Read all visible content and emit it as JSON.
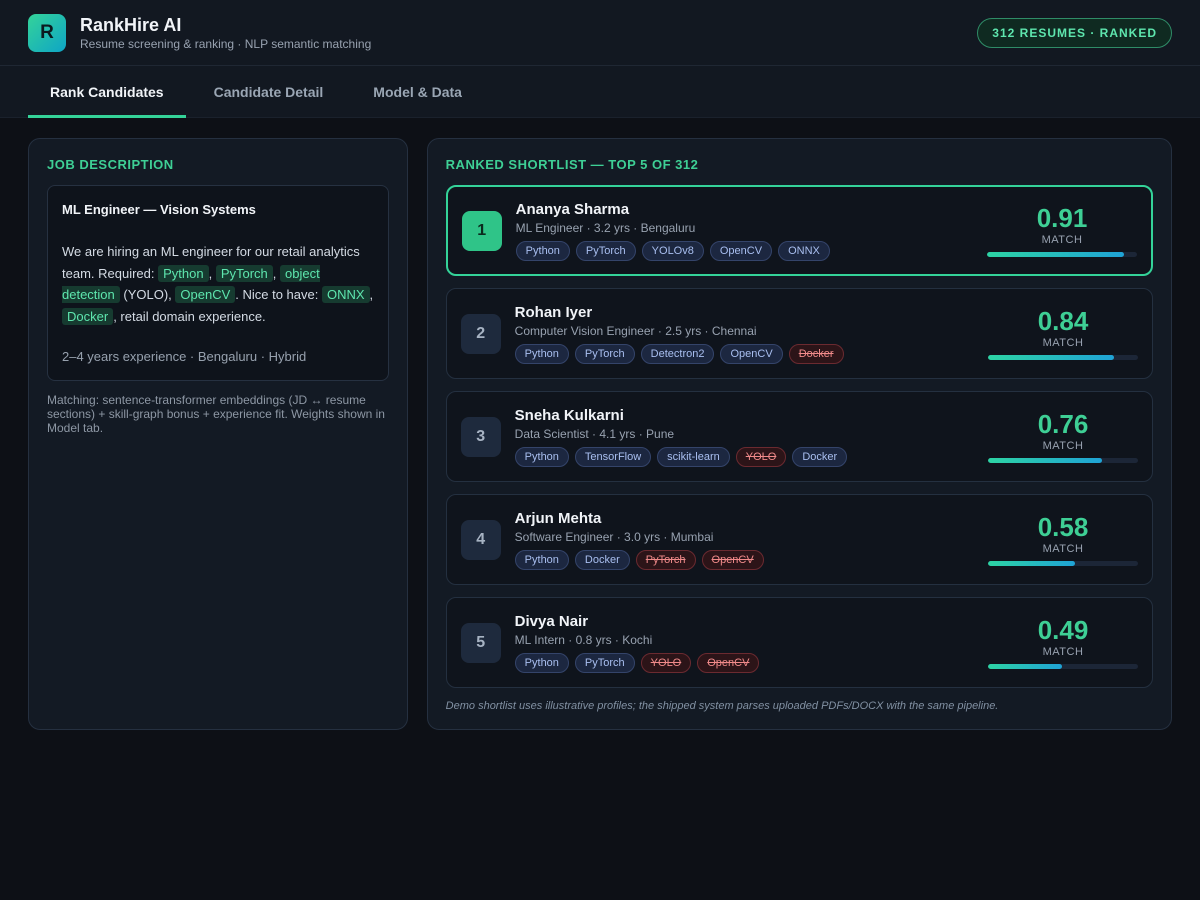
{
  "header": {
    "logo_letter": "R",
    "title": "RankHire AI",
    "subtitle": "Resume screening & ranking · NLP semantic matching",
    "pill": "312 RESUMES · RANKED"
  },
  "tabs": [
    {
      "label": "Rank Candidates",
      "active": true
    },
    {
      "label": "Candidate Detail",
      "active": false
    },
    {
      "label": "Model & Data",
      "active": false
    }
  ],
  "job": {
    "section_title": "JOB DESCRIPTION",
    "title": "ML Engineer — Vision Systems",
    "body_parts": [
      {
        "text": "We are hiring an ML engineer for our retail analytics team. Required: ",
        "hl": false
      },
      {
        "text": "Python",
        "hl": true
      },
      {
        "text": ", ",
        "hl": false
      },
      {
        "text": "PyTorch",
        "hl": true
      },
      {
        "text": ", ",
        "hl": false
      },
      {
        "text": "object detection",
        "hl": true
      },
      {
        "text": " (YOLO), ",
        "hl": false
      },
      {
        "text": "OpenCV",
        "hl": true
      },
      {
        "text": ". Nice to have: ",
        "hl": false
      },
      {
        "text": "ONNX",
        "hl": true
      },
      {
        "text": ", ",
        "hl": false
      },
      {
        "text": "Docker",
        "hl": true
      },
      {
        "text": ", retail domain experience.",
        "hl": false
      }
    ],
    "meta": "2–4 years experience · Bengaluru · Hybrid",
    "matching_note": "Matching: sentence-transformer embeddings (JD ↔ resume sections) + skill-graph bonus + experience fit. Weights shown in Model tab."
  },
  "shortlist": {
    "section_title": "RANKED SHORTLIST — TOP 5 OF 312",
    "score_label": "MATCH",
    "footnote": "Demo shortlist uses illustrative profiles; the shipped system parses uploaded PDFs/DOCX with the same pipeline.",
    "candidates": [
      {
        "rank": "1",
        "name": "Ananya Sharma",
        "meta": "ML Engineer · 3.2 yrs · Bengaluru",
        "score": "0.91",
        "score_fraction": 0.91,
        "skills": [
          {
            "label": "Python",
            "missing": false
          },
          {
            "label": "PyTorch",
            "missing": false
          },
          {
            "label": "YOLOv8",
            "missing": false
          },
          {
            "label": "OpenCV",
            "missing": false
          },
          {
            "label": "ONNX",
            "missing": false
          }
        ]
      },
      {
        "rank": "2",
        "name": "Rohan Iyer",
        "meta": "Computer Vision Engineer · 2.5 yrs · Chennai",
        "score": "0.84",
        "score_fraction": 0.84,
        "skills": [
          {
            "label": "Python",
            "missing": false
          },
          {
            "label": "PyTorch",
            "missing": false
          },
          {
            "label": "Detectron2",
            "missing": false
          },
          {
            "label": "OpenCV",
            "missing": false
          },
          {
            "label": "Docker",
            "missing": true
          }
        ]
      },
      {
        "rank": "3",
        "name": "Sneha Kulkarni",
        "meta": "Data Scientist · 4.1 yrs · Pune",
        "score": "0.76",
        "score_fraction": 0.76,
        "skills": [
          {
            "label": "Python",
            "missing": false
          },
          {
            "label": "TensorFlow",
            "missing": false
          },
          {
            "label": "scikit-learn",
            "missing": false
          },
          {
            "label": "YOLO",
            "missing": true
          },
          {
            "label": "Docker",
            "missing": false
          }
        ]
      },
      {
        "rank": "4",
        "name": "Arjun Mehta",
        "meta": "Software Engineer · 3.0 yrs · Mumbai",
        "score": "0.58",
        "score_fraction": 0.58,
        "skills": [
          {
            "label": "Python",
            "missing": false
          },
          {
            "label": "Docker",
            "missing": false
          },
          {
            "label": "PyTorch",
            "missing": true
          },
          {
            "label": "OpenCV",
            "missing": true
          }
        ]
      },
      {
        "rank": "5",
        "name": "Divya Nair",
        "meta": "ML Intern · 0.8 yrs · Kochi",
        "score": "0.49",
        "score_fraction": 0.49,
        "skills": [
          {
            "label": "Python",
            "missing": false
          },
          {
            "label": "PyTorch",
            "missing": false
          },
          {
            "label": "YOLO",
            "missing": true
          },
          {
            "label": "OpenCV",
            "missing": true
          }
        ]
      }
    ]
  }
}
